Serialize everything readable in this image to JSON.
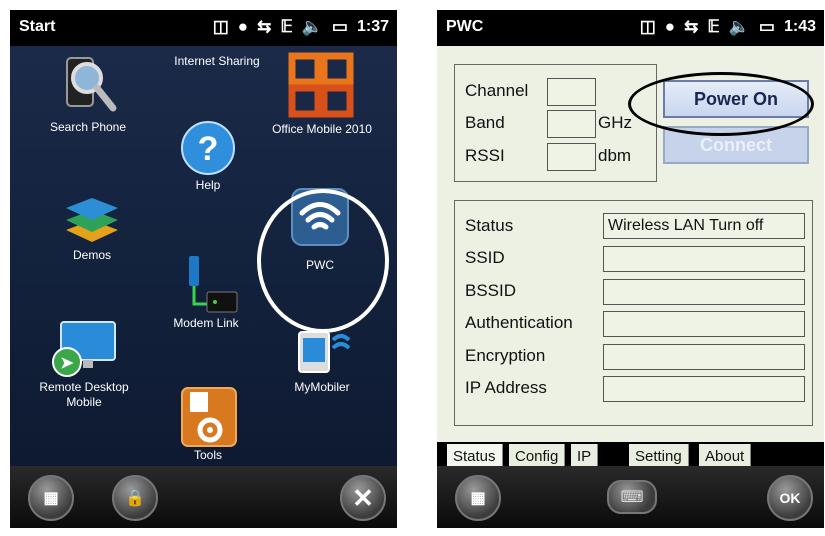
{
  "left": {
    "statusbar": {
      "title": "Start",
      "time": "1:37"
    },
    "apps": [
      {
        "label": "Internet Sharing"
      },
      {
        "label": "Search Phone"
      },
      {
        "label": "Office Mobile 2010"
      },
      {
        "label": "Help"
      },
      {
        "label": "Demos"
      },
      {
        "label": "PWC"
      },
      {
        "label": "Modem Link"
      },
      {
        "label": "Remote Desktop Mobile"
      },
      {
        "label": "MyMobiler"
      },
      {
        "label": "Tools"
      }
    ]
  },
  "right": {
    "statusbar": {
      "title": "PWC",
      "time": "1:43"
    },
    "radio": {
      "channel_label": "Channel",
      "band_label": "Band",
      "band_unit": "GHz",
      "rssi_label": "RSSI",
      "rssi_unit": "dbm"
    },
    "buttons": {
      "power_on": "Power On",
      "connect": "Connect"
    },
    "status_fields": [
      {
        "label": "Status",
        "value": "Wireless LAN Turn off"
      },
      {
        "label": "SSID",
        "value": ""
      },
      {
        "label": "BSSID",
        "value": ""
      },
      {
        "label": "Authentication",
        "value": ""
      },
      {
        "label": "Encryption",
        "value": ""
      },
      {
        "label": "IP Address",
        "value": ""
      }
    ],
    "tabs": [
      "Status",
      "Config",
      "IP",
      "Setting",
      "About"
    ],
    "ok_label": "OK"
  }
}
